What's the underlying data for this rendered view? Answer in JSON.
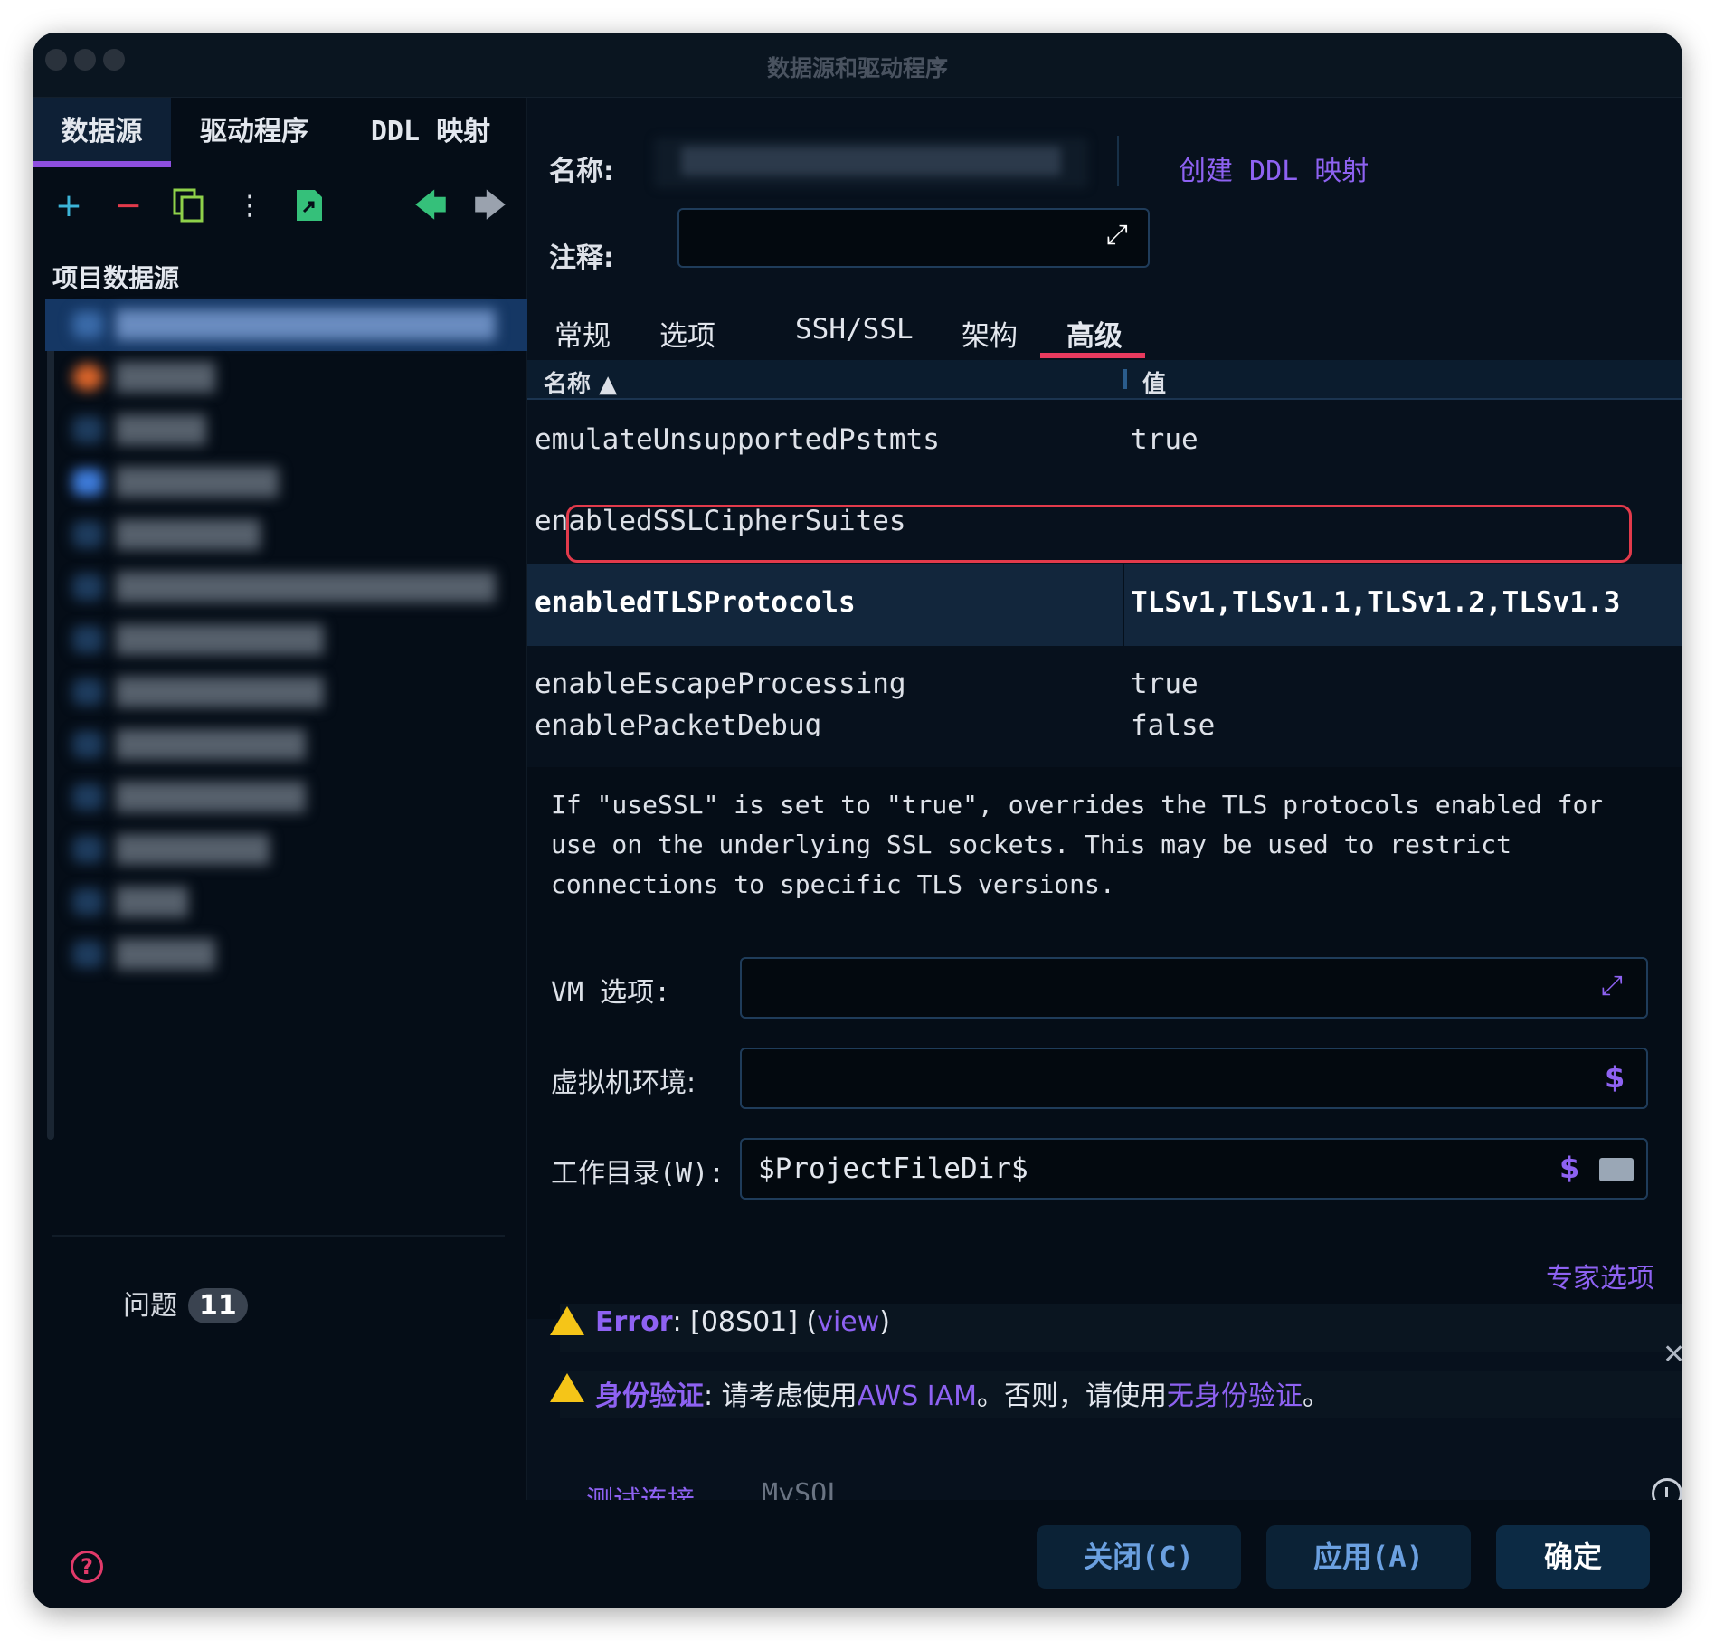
{
  "window": {
    "title": "数据源和驱动程序"
  },
  "left": {
    "tabs": [
      "数据源",
      "驱动程序",
      "DDL 映射"
    ],
    "toolbar": {
      "add_icon": "plus-icon",
      "remove_icon": "minus-icon",
      "copy_icon": "copy-icon",
      "more_icon": "more-vertical-icon",
      "export_icon": "file-export-icon",
      "back_icon": "arrow-left-icon",
      "forward_icon": "arrow-right-icon"
    },
    "section_title": "项目数据源",
    "problems": {
      "label": "问题",
      "count": "11"
    }
  },
  "right": {
    "name_label": "名称:",
    "create_ddl_link": "创建 DDL 映射",
    "comment_label": "注释:",
    "tabs": [
      "常规",
      "选项",
      "SSH/SSL",
      "架构",
      "高级"
    ],
    "active_tab": "高级",
    "table": {
      "col_name": "名称",
      "col_value": "值",
      "rows": [
        {
          "name": "emulateUnsupportedPstmts",
          "value": "true"
        },
        {
          "name": "enabledSSLCipherSuites",
          "value": ""
        },
        {
          "name": "enabledTLSProtocols",
          "value": "TLSv1,TLSv1.1,TLSv1.2,TLSv1.3",
          "selected": true
        },
        {
          "name": "enableEscapeProcessing",
          "value": "true"
        },
        {
          "name": "enablePacketDebug",
          "value": "false"
        }
      ]
    },
    "description": "If \"useSSL\" is set to \"true\", overrides the TLS protocols enabled for use on the underlying SSL sockets. This may be used to restrict connections to specific TLS versions.",
    "vm_options_label": "VM 选项:",
    "vm_env_label": "虚拟机环境:",
    "workdir_label": "工作目录(W):",
    "workdir_value": "$ProjectFileDir$",
    "macro_symbol": "$",
    "expert_options": "专家选项",
    "error": {
      "label": "Error",
      "code": ": [08S01] (",
      "view_link": "view",
      "close": ")"
    },
    "auth": {
      "label": "身份验证",
      "text1": ": 请考虑使用",
      "link1": "AWS IAM",
      "text2": "。否则，请使用",
      "link2": "无身份验证",
      "text3": "。"
    },
    "test_connection": "测试连接",
    "driver": "MySQL"
  },
  "footer": {
    "close_button": "关闭(C)",
    "apply_button": "应用(A)",
    "ok_button": "确定"
  },
  "colors": {
    "accent": "#8e62f2",
    "selection": "#153764",
    "highlight_border": "#e23a4b",
    "warning": "#f5c518"
  }
}
